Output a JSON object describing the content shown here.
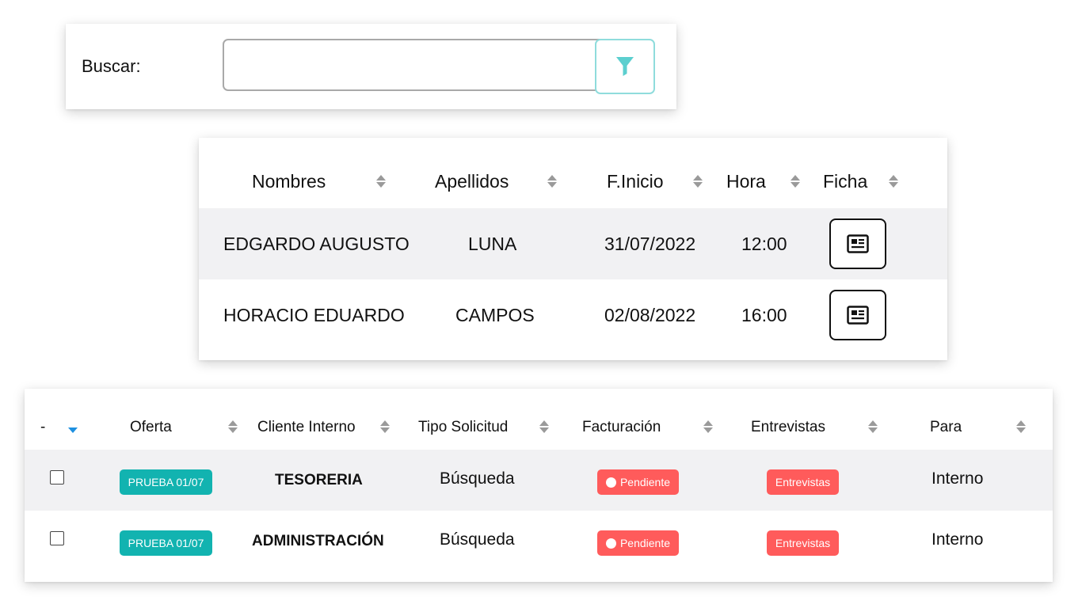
{
  "search": {
    "label": "Buscar:",
    "value": "",
    "placeholder": ""
  },
  "interviews": {
    "columns": [
      "Nombres",
      "Apellidos",
      "F.Inicio",
      "Hora",
      "Ficha"
    ],
    "rows": [
      {
        "nombres": "EDGARDO AUGUSTO",
        "apellidos": "LUNA",
        "inicio": "31/07/2022",
        "hora": "12:00"
      },
      {
        "nombres": "HORACIO EDUARDO",
        "apellidos": "CAMPOS",
        "inicio": "02/08/2022",
        "hora": "16:00"
      }
    ]
  },
  "offers": {
    "columns": [
      "-",
      "Oferta",
      "Cliente Interno",
      "Tipo Solicitud",
      "Facturación",
      "Entrevistas",
      "Para"
    ],
    "rows": [
      {
        "oferta": "PRUEBA 01/07",
        "cliente": "TESORERIA",
        "tipo": "Búsqueda",
        "facturacion": "Pendiente",
        "entrevistas": "Entrevistas",
        "para": "Interno"
      },
      {
        "oferta": "PRUEBA 01/07",
        "cliente": "ADMINISTRACIÓN",
        "tipo": "Búsqueda",
        "facturacion": "Pendiente",
        "entrevistas": "Entrevistas",
        "para": "Interno"
      }
    ]
  },
  "colors": {
    "teal_badge": "#12b3b0",
    "red_badge": "#ff5b5b",
    "filter_icon": "#5ccfcf",
    "sort_active": "#1e90e0"
  },
  "icons": [
    "filter-icon",
    "sort-icon",
    "id-card-icon",
    "sort-desc-icon"
  ]
}
